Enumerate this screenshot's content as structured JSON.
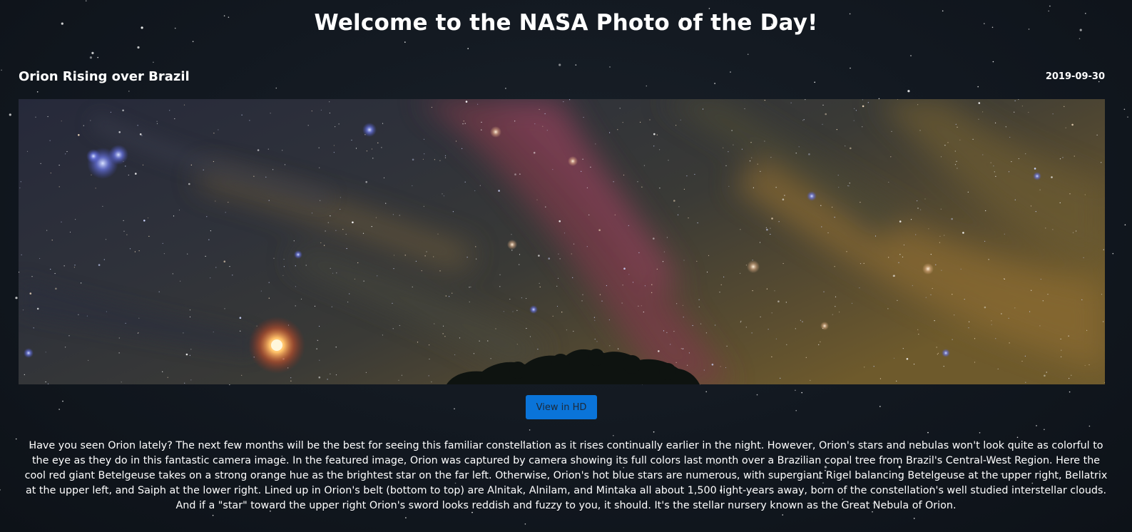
{
  "header": {
    "title": "Welcome to the NASA Photo of the Day!"
  },
  "apod": {
    "title": "Orion Rising over Brazil",
    "date": "2019-09-30",
    "image_alt": "Orion Rising over Brazil",
    "hd_button_label": "View in HD",
    "explanation": "Have you seen Orion lately? The next few months will be the best for seeing this familiar constellation as it rises continually earlier in the night. However, Orion's stars and nebulas won't look quite as colorful to the eye as they do in this fantastic camera image. In the featured image, Orion was captured by camera showing its full colors last month over a Brazilian copal tree from Brazil's Central-West Region. Here the cool red giant Betelgeuse takes on a strong orange hue as the brightest star on the far left. Otherwise, Orion's hot blue stars are numerous, with supergiant Rigel balancing Betelgeuse at the upper right, Bellatrix at the upper left, and Saiph at the lower right. Lined up in Orion's belt (bottom to top) are Alnitak, Alnilam, and Mintaka all about 1,500 light-years away, born of the constellation's well studied interstellar clouds. And if a \"star\" toward the upper right Orion's sword looks reddish and fuzzy to you, it should. It's the stellar nursery known as the Great Nebula of Orion."
  },
  "colors": {
    "background": "#121820",
    "button": "#0a74d9",
    "button_text": "#1c2a3a",
    "text": "#ffffff"
  }
}
